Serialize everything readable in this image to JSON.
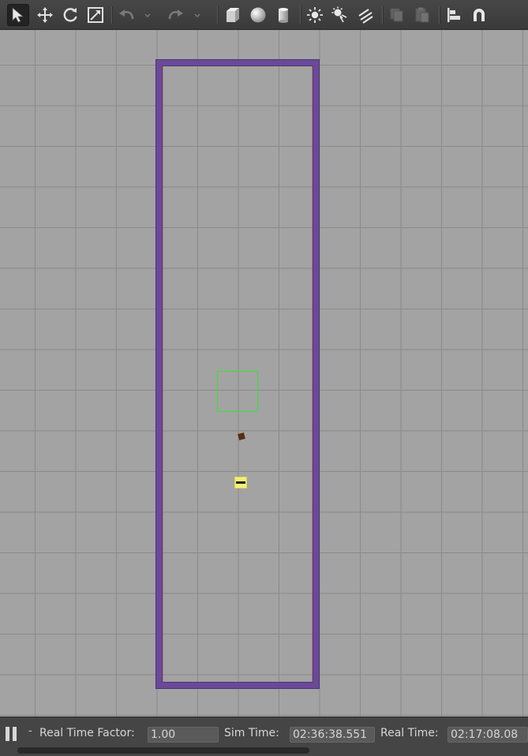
{
  "toolbar": {
    "tools": [
      {
        "name": "select-mode-tool",
        "icon": "arrow-cursor-icon",
        "active": true
      },
      {
        "name": "translate-mode-tool",
        "icon": "move-arrows-icon"
      },
      {
        "name": "rotate-mode-tool",
        "icon": "rotate-icon"
      },
      {
        "name": "scale-mode-tool",
        "icon": "scale-icon"
      },
      {
        "name": "undo-tool",
        "icon": "undo-icon",
        "disabled": true
      },
      {
        "name": "undo-dropdown",
        "icon": "chevron-down-icon",
        "disabled": true
      },
      {
        "name": "redo-tool",
        "icon": "redo-icon",
        "disabled": true
      },
      {
        "name": "redo-dropdown",
        "icon": "chevron-down-icon",
        "disabled": true
      },
      {
        "name": "box-shape-tool",
        "icon": "box-icon"
      },
      {
        "name": "sphere-shape-tool",
        "icon": "sphere-icon"
      },
      {
        "name": "cylinder-shape-tool",
        "icon": "cylinder-icon"
      },
      {
        "name": "point-light-tool",
        "icon": "point-light-icon"
      },
      {
        "name": "spot-light-tool",
        "icon": "spot-light-icon"
      },
      {
        "name": "directional-light-tool",
        "icon": "directional-light-icon"
      },
      {
        "name": "copy-tool",
        "icon": "copy-icon",
        "disabled": true
      },
      {
        "name": "paste-tool",
        "icon": "paste-icon",
        "disabled": true
      },
      {
        "name": "align-tool",
        "icon": "align-icon"
      },
      {
        "name": "snap-tool",
        "icon": "magnet-icon"
      }
    ]
  },
  "status": {
    "dash": "-",
    "real_time_factor_label": "Real Time Factor:",
    "real_time_factor_value": "1.00",
    "sim_time_label": "Sim Time:",
    "sim_time_value": "02:36:38.551",
    "real_time_label": "Real Time:",
    "real_time_value": "02:17:08.08"
  },
  "colors": {
    "wall": "#6a4a98",
    "selection": "#2ee82e",
    "robot": "#f4f078",
    "box": "#5a2d12",
    "ground": "#a3a3a3"
  }
}
